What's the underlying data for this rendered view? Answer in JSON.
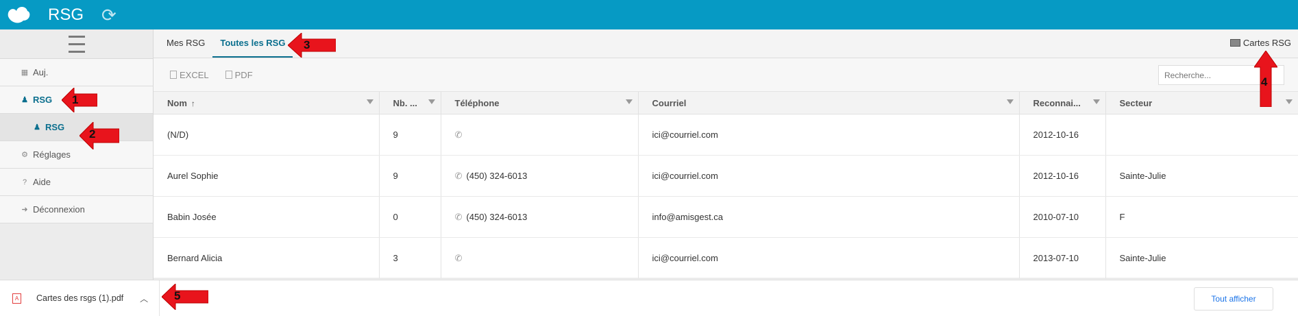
{
  "app": {
    "title": "RSG"
  },
  "sidebar": {
    "items": [
      {
        "label": "Auj."
      },
      {
        "label": "RSG"
      },
      {
        "label": "RSG"
      },
      {
        "label": "Réglages"
      },
      {
        "label": "Aide"
      },
      {
        "label": "Déconnexion"
      }
    ]
  },
  "tabs": [
    {
      "label": "Mes RSG"
    },
    {
      "label": "Toutes les RSG"
    }
  ],
  "cartes_button": "Cartes RSG",
  "toolbar": {
    "excel": "EXCEL",
    "pdf": "PDF",
    "search_placeholder": "Recherche..."
  },
  "table": {
    "columns": [
      "Nom",
      "Nb. ...",
      "Téléphone",
      "Courriel",
      "Reconnai...",
      "Secteur"
    ],
    "sort_indicator": "↑",
    "rows": [
      [
        "(N/D)",
        "9",
        "",
        "ici@courriel.com",
        "2012-10-16",
        ""
      ],
      [
        "Aurel Sophie",
        "9",
        "(450) 324-6013",
        "ici@courriel.com",
        "2012-10-16",
        "Sainte-Julie"
      ],
      [
        "Babin Josée",
        "0",
        "(450) 324-6013",
        "info@amisgest.ca",
        "2010-07-10",
        "F"
      ],
      [
        "Bernard Alicia",
        "3",
        "",
        "ici@courriel.com",
        "2013-07-10",
        "Sainte-Julie"
      ]
    ]
  },
  "downloads": {
    "file": "Cartes des rsgs (1).pdf",
    "show_all": "Tout afficher"
  },
  "annotations": [
    "1",
    "2",
    "3",
    "4",
    "5"
  ],
  "colors": {
    "header": "#069ac4",
    "accent": "#0b6f8e",
    "arrow": "#e8141c"
  }
}
